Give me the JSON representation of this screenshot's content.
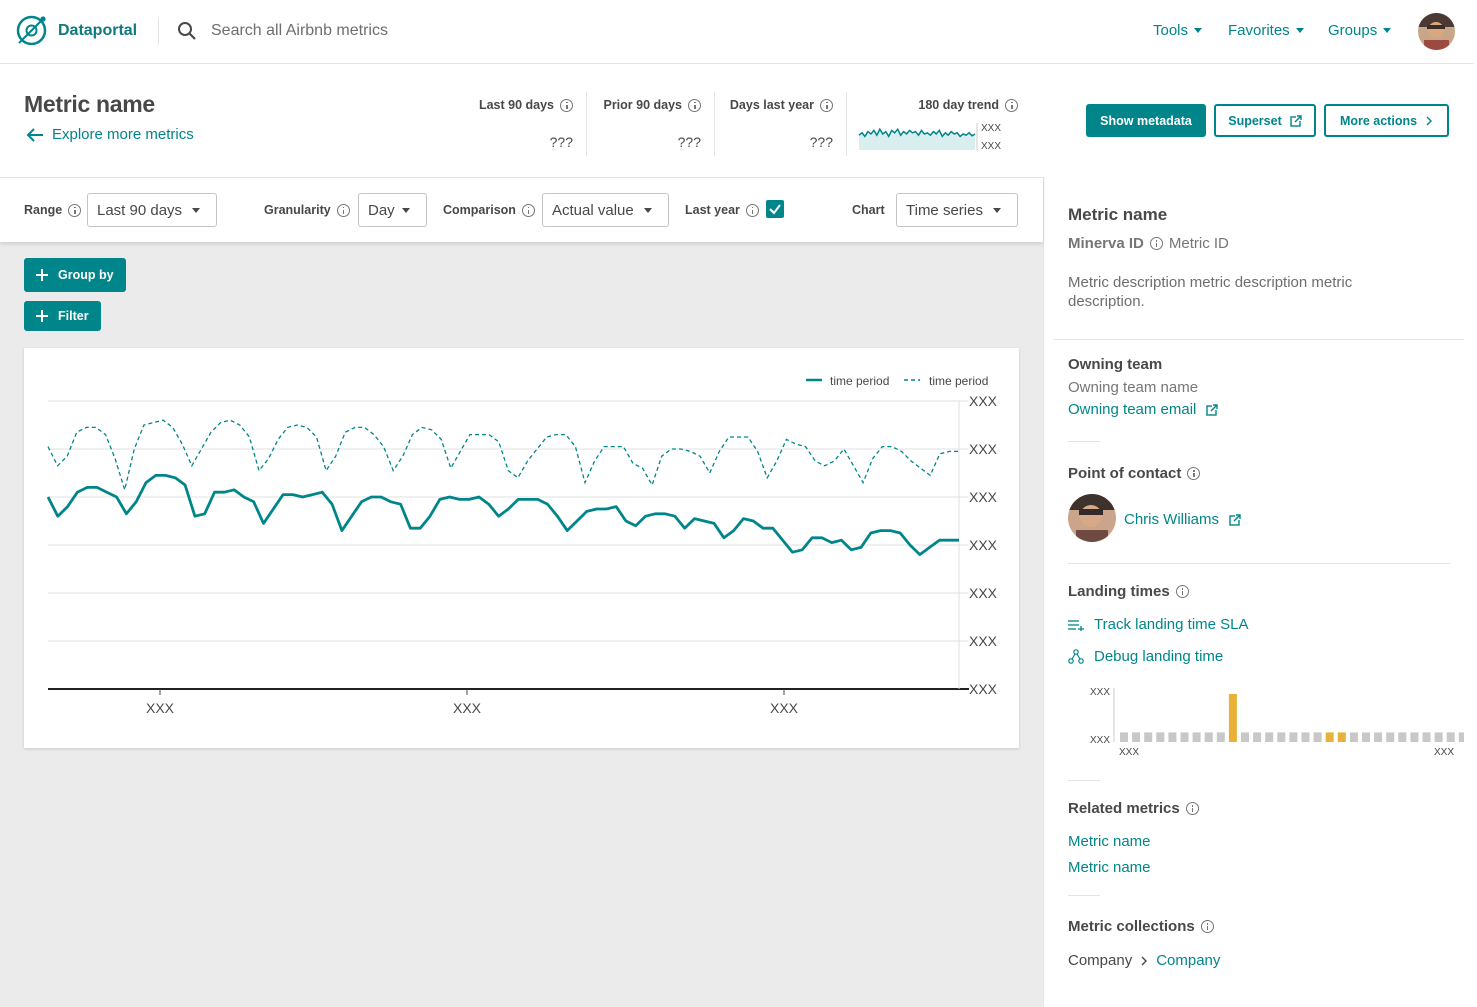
{
  "nav": {
    "brand": "Dataportal",
    "search_placeholder": "Search all Airbnb metrics",
    "menus": [
      "Tools",
      "Favorites",
      "Groups"
    ]
  },
  "header": {
    "title": "Metric name",
    "explore_link": "Explore more metrics",
    "stats": [
      {
        "label": "Last 90 days",
        "value": "???"
      },
      {
        "label": "Prior 90 days",
        "value": "???"
      },
      {
        "label": "Days last year",
        "value": "???"
      }
    ],
    "trend": {
      "label": "180 day trend",
      "top_label": "XXX",
      "bottom_label": "XXX"
    },
    "buttons": {
      "show_metadata": "Show metadata",
      "superset": "Superset",
      "more_actions": "More actions"
    }
  },
  "filters": {
    "range_label": "Range",
    "range_value": "Last 90 days",
    "granularity_label": "Granularity",
    "granularity_value": "Day",
    "comparison_label": "Comparison",
    "comparison_value": "Actual value",
    "last_year_label": "Last year",
    "last_year_checked": true,
    "chart_label": "Chart",
    "chart_value": "Time series"
  },
  "actions": {
    "group_by": "Group by",
    "filter": "Filter"
  },
  "colors": {
    "accent": "#00868a",
    "highlight_bar": "#e8b23a",
    "bar": "#c8c8c8"
  },
  "chart_data": {
    "type": "line",
    "legend": [
      {
        "name": "time period",
        "style": "solid"
      },
      {
        "name": "time period",
        "style": "dashed"
      }
    ],
    "y_tick_labels": [
      "XXX",
      "XXX",
      "XXX",
      "XXX",
      "XXX",
      "XXX",
      "XXX"
    ],
    "x_tick_labels": [
      "XXX",
      "XXX",
      "XXX"
    ],
    "ylim": [
      0,
      6
    ],
    "series": [
      {
        "name": "time period",
        "style": "solid",
        "values": [
          4.0,
          3.6,
          3.8,
          4.1,
          4.2,
          4.2,
          4.1,
          4.0,
          3.65,
          3.9,
          4.3,
          4.45,
          4.45,
          4.4,
          4.25,
          3.6,
          3.65,
          4.1,
          4.1,
          4.15,
          4.0,
          3.9,
          3.45,
          3.75,
          4.05,
          4.05,
          4.0,
          4.05,
          4.1,
          3.85,
          3.3,
          3.6,
          3.9,
          4.0,
          4.0,
          3.9,
          3.85,
          3.35,
          3.35,
          3.6,
          3.95,
          4.0,
          3.95,
          3.95,
          4.0,
          3.85,
          3.6,
          3.75,
          3.95,
          3.95,
          3.95,
          3.85,
          3.6,
          3.3,
          3.5,
          3.7,
          3.75,
          3.75,
          3.8,
          3.5,
          3.4,
          3.6,
          3.65,
          3.65,
          3.6,
          3.35,
          3.55,
          3.5,
          3.45,
          3.15,
          3.3,
          3.55,
          3.5,
          3.35,
          3.35,
          3.1,
          2.85,
          2.9,
          3.15,
          3.15,
          3.05,
          3.1,
          2.9,
          2.95,
          3.25,
          3.3,
          3.3,
          3.25,
          3.0,
          2.8,
          2.95,
          3.1,
          3.1,
          3.1
        ]
      },
      {
        "name": "time period",
        "style": "dashed",
        "values": [
          5.05,
          4.65,
          4.85,
          5.35,
          5.45,
          5.45,
          5.3,
          4.8,
          4.15,
          5.0,
          5.5,
          5.55,
          5.6,
          5.45,
          5.1,
          4.65,
          5.0,
          5.35,
          5.55,
          5.6,
          5.5,
          5.25,
          4.55,
          4.8,
          5.2,
          5.45,
          5.5,
          5.45,
          5.25,
          4.55,
          4.85,
          5.35,
          5.45,
          5.45,
          5.3,
          5.05,
          4.55,
          4.85,
          5.3,
          5.45,
          5.4,
          5.2,
          4.6,
          4.95,
          5.3,
          5.3,
          5.3,
          5.15,
          4.55,
          4.4,
          4.75,
          5.0,
          5.25,
          5.3,
          5.3,
          5.05,
          4.3,
          4.75,
          5.05,
          5.05,
          5.05,
          4.7,
          4.6,
          4.25,
          4.85,
          5.0,
          5.0,
          4.95,
          4.85,
          4.5,
          4.95,
          5.25,
          5.25,
          5.25,
          4.95,
          4.4,
          4.75,
          5.2,
          5.1,
          5.05,
          4.75,
          4.65,
          4.75,
          5.0,
          4.65,
          4.3,
          4.8,
          5.05,
          5.05,
          4.95,
          4.75,
          4.6,
          4.45,
          4.9,
          4.95,
          4.95
        ]
      }
    ],
    "trend_series": [
      0.4,
      0.6,
      0.3,
      0.7,
      0.5,
      0.8,
      0.4,
      0.9,
      0.5,
      0.7,
      0.3,
      0.8,
      0.6,
      0.9,
      0.4,
      0.7,
      0.5,
      0.8,
      0.6,
      0.7,
      0.4,
      0.8,
      0.5,
      0.6,
      0.4,
      0.7,
      0.5,
      0.8,
      0.3,
      0.6,
      0.4,
      0.7,
      0.5,
      0.6,
      0.3,
      0.5,
      0.4,
      0.6,
      0.35,
      0.5
    ]
  },
  "right_panel": {
    "metric_name": "Metric name",
    "minerva_label": "Minerva ID",
    "metric_id": "Metric ID",
    "description": "Metric description metric description metric description.",
    "owning_team_title": "Owning team",
    "owning_team_name": "Owning team name",
    "owning_team_email": "Owning team email",
    "point_of_contact_title": "Point of contact",
    "contact_name": "Chris Williams",
    "landing_times_title": "Landing times",
    "track_sla": "Track landing time SLA",
    "debug_landing": "Debug landing time",
    "landing_chart": {
      "y_labels": [
        "XXX",
        "XXX"
      ],
      "x_labels": [
        "XXX",
        "XXX"
      ],
      "bars": [
        0.2,
        0.2,
        0.2,
        0.2,
        0.2,
        0.2,
        0.2,
        0.2,
        0.2,
        1.0,
        0.2,
        0.2,
        0.2,
        0.2,
        0.2,
        0.2,
        0.2,
        0.2,
        0.2,
        0.2,
        0.2,
        0.2,
        0.2,
        0.2,
        0.2,
        0.2,
        0.2,
        0.2,
        0.2,
        0.2,
        0.2,
        0.2,
        0.2,
        0.2,
        0.2,
        0.2
      ],
      "highlight": [
        9,
        17,
        18
      ]
    },
    "related_metrics_title": "Related metrics",
    "related_metrics": [
      "Metric name",
      "Metric name"
    ],
    "collections_title": "Metric collections",
    "breadcrumb_root": "Company",
    "breadcrumb_leaf": "Company"
  }
}
